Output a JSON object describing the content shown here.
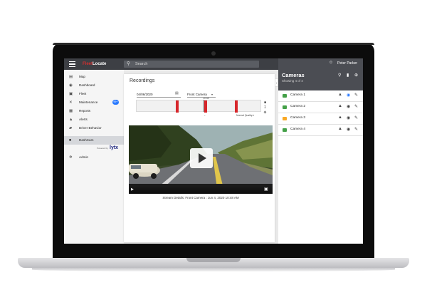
{
  "app": {
    "logo_prefix": "Fleet",
    "logo_suffix": "Locate"
  },
  "search": {
    "placeholder": "Search"
  },
  "user": {
    "name": "Peter Parker"
  },
  "sidebar": {
    "items": [
      {
        "icon": "map-icon",
        "glyph": "▤",
        "label": "Map"
      },
      {
        "icon": "dashboard-icon",
        "glyph": "◉",
        "label": "Dashboard"
      },
      {
        "icon": "fleet-icon",
        "glyph": "▣",
        "label": "Fleet"
      },
      {
        "icon": "maintenance-icon",
        "glyph": "✕",
        "label": "Maintenance",
        "badge": "99+"
      },
      {
        "icon": "reports-icon",
        "glyph": "▦",
        "label": "Reports"
      },
      {
        "icon": "alerts-icon",
        "glyph": "▲",
        "label": "Alerts"
      },
      {
        "icon": "driver-behavior-icon",
        "glyph": "▰",
        "label": "Driver Behavior"
      },
      {
        "icon": "dashcam-icon",
        "glyph": "■",
        "label": "DashCam",
        "active": true
      },
      {
        "icon": "admin-icon",
        "glyph": "✲",
        "label": "Admin"
      }
    ],
    "powered_by": "Powered by",
    "partner": "lytx"
  },
  "recordings": {
    "title": "Recordings",
    "date": "04/06/2020",
    "camera": "Front Camera",
    "time_label": "10:48",
    "quality": "Normal Quality",
    "stream_details": "Stream Details: Front Camera : Jun 4, 2020 10:48 AM"
  },
  "cameras": {
    "title": "Cameras",
    "subtitle": "Showing 4 of 4",
    "items": [
      {
        "name": "Camera 1",
        "color": "#43a047",
        "viewing": true
      },
      {
        "name": "Camera 2",
        "color": "#43a047",
        "viewing": false
      },
      {
        "name": "Camera 3",
        "color": "#f9a825",
        "viewing": false
      },
      {
        "name": "Camera 4",
        "color": "#43a047",
        "viewing": false
      }
    ]
  },
  "colors": {
    "accent": "#2979ff",
    "brand_red": "#d32f2f",
    "recording_marker": "#d7262b",
    "topbar": "#3d3f44",
    "camera_header": "#4b4d53"
  }
}
